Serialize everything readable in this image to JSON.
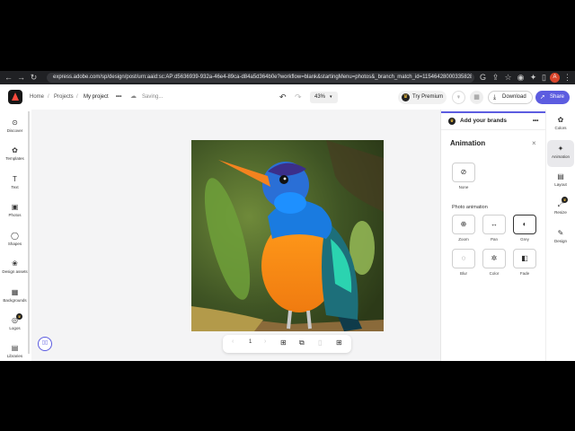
{
  "browser": {
    "url": "express.adobe.com/sp/design/post/urn:aaid:sc:AP:d5636939-932a-46e4-89ca-d84a5d364b0e?workflow=blank&startingMenu=photos&_branch_match_id=1154642800033582828..."
  },
  "topbar": {
    "home": "Home",
    "projects": "Projects",
    "project_name": "My project",
    "status": "Saving...",
    "zoom": "43%",
    "premium": "Try Premium",
    "download": "Download",
    "share": "Share",
    "avatar_letter": "A"
  },
  "left_rail": [
    {
      "label": "Discover",
      "icon": "compass-icon"
    },
    {
      "label": "Templates",
      "icon": "templates-icon"
    },
    {
      "label": "Text",
      "icon": "text-icon"
    },
    {
      "label": "Photos",
      "icon": "photo-icon"
    },
    {
      "label": "Shapes",
      "icon": "shapes-icon"
    },
    {
      "label": "Design assets",
      "icon": "assets-icon"
    },
    {
      "label": "Backgrounds",
      "icon": "backgrounds-icon"
    },
    {
      "label": "Logos",
      "icon": "logos-icon"
    },
    {
      "label": "Libraries",
      "icon": "libraries-icon"
    }
  ],
  "pager": {
    "page": "1"
  },
  "panel": {
    "brand": "Add your brands",
    "title": "Animation",
    "none": "None",
    "section": "Photo animation",
    "options": [
      {
        "label": "Zoom",
        "icon": "zoom-icon"
      },
      {
        "label": "Pan",
        "icon": "pan-icon"
      },
      {
        "label": "Grey",
        "icon": "grey-icon"
      },
      {
        "label": "Blur",
        "icon": "blur-icon"
      },
      {
        "label": "Color",
        "icon": "color-icon"
      },
      {
        "label": "Fade",
        "icon": "fade-icon"
      }
    ],
    "selected": "Grey"
  },
  "right_rail": [
    {
      "label": "Colors",
      "icon": "palette-icon"
    },
    {
      "label": "Animation",
      "icon": "animation-icon"
    },
    {
      "label": "Layout",
      "icon": "layout-icon"
    },
    {
      "label": "Resize",
      "icon": "resize-icon"
    },
    {
      "label": "Design",
      "icon": "design-icon"
    }
  ],
  "colors": {
    "accent": "#5c5ce0",
    "logo_red": "#ff4a3d"
  }
}
